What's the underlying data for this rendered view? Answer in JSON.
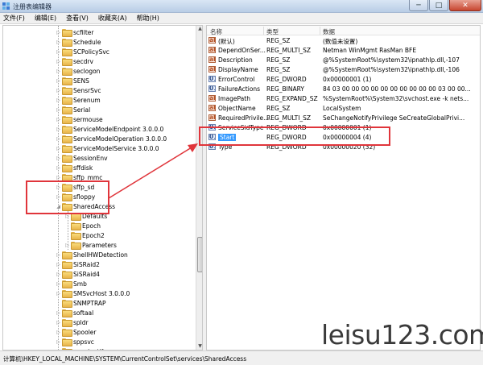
{
  "window": {
    "title": "注册表编辑器",
    "minimize_glyph": "─",
    "maximize_glyph": "□",
    "close_glyph": "✕"
  },
  "menu": [
    "文件(F)",
    "编辑(E)",
    "查看(V)",
    "收藏夹(A)",
    "帮助(H)"
  ],
  "tree": {
    "items": [
      {
        "label": "scfilter",
        "expander": "▷"
      },
      {
        "label": "Schedule",
        "expander": "▷"
      },
      {
        "label": "SCPolicySvc",
        "expander": "▷"
      },
      {
        "label": "secdrv",
        "expander": "▷"
      },
      {
        "label": "seclogon",
        "expander": "▷"
      },
      {
        "label": "SENS",
        "expander": "▷"
      },
      {
        "label": "SensrSvc",
        "expander": "▷"
      },
      {
        "label": "Serenum",
        "expander": "▷"
      },
      {
        "label": "Serial",
        "expander": "▷"
      },
      {
        "label": "sermouse",
        "expander": "▷"
      },
      {
        "label": "ServiceModelEndpoint 3.0.0.0",
        "expander": "▷"
      },
      {
        "label": "ServiceModelOperation 3.0.0.0",
        "expander": "▷"
      },
      {
        "label": "ServiceModelService 3.0.0.0",
        "expander": "▷"
      },
      {
        "label": "SessionEnv",
        "expander": "▷"
      },
      {
        "label": "sffdisk",
        "expander": "▷"
      },
      {
        "label": "sffp_mmc",
        "expander": "▷"
      },
      {
        "label": "sffp_sd",
        "expander": "▷"
      },
      {
        "label": "sfloppy",
        "expander": "▷"
      },
      {
        "label": "SharedAccess",
        "expander": "◢"
      },
      {
        "label": "Defaults",
        "expander": "▷"
      },
      {
        "label": "Epoch",
        "expander": ""
      },
      {
        "label": "Epoch2",
        "expander": ""
      },
      {
        "label": "Parameters",
        "expander": "▷"
      },
      {
        "label": "ShellHWDetection",
        "expander": "▷"
      },
      {
        "label": "SiSRaid2",
        "expander": "▷"
      },
      {
        "label": "SiSRaid4",
        "expander": "▷"
      },
      {
        "label": "Smb",
        "expander": "▷"
      },
      {
        "label": "SMSvcHost 3.0.0.0",
        "expander": "▷"
      },
      {
        "label": "SNMPTRAP",
        "expander": ""
      },
      {
        "label": "softaal",
        "expander": "▷"
      },
      {
        "label": "spldr",
        "expander": "▷"
      },
      {
        "label": "Spooler",
        "expander": "▷"
      },
      {
        "label": "sppsvc",
        "expander": "▷"
      },
      {
        "label": "sppuinotify",
        "expander": "▷"
      },
      {
        "label": "srv",
        "expander": "▷"
      }
    ],
    "scroll_up": "▲",
    "scroll_down": "▼"
  },
  "values": {
    "columns": [
      "名称",
      "类型",
      "数据"
    ],
    "rows": [
      {
        "icon": "ab",
        "name": "(默认)",
        "type": "REG_SZ",
        "data": "(数值未设置)"
      },
      {
        "icon": "ab",
        "name": "DependOnSer...",
        "type": "REG_MULTI_SZ",
        "data": "Netman WinMgmt RasMan BFE"
      },
      {
        "icon": "ab",
        "name": "Description",
        "type": "REG_SZ",
        "data": "@%SystemRoot%\\system32\\ipnathlp.dll,-107"
      },
      {
        "icon": "ab",
        "name": "DisplayName",
        "type": "REG_SZ",
        "data": "@%SystemRoot%\\system32\\ipnathlp.dll,-106"
      },
      {
        "icon": "011",
        "name": "ErrorControl",
        "type": "REG_DWORD",
        "data": "0x00000001 (1)"
      },
      {
        "icon": "011",
        "name": "FailureActions",
        "type": "REG_BINARY",
        "data": "84 03 00 00 00 00 00 00 00 00 00 00 03 00 00..."
      },
      {
        "icon": "ab",
        "name": "ImagePath",
        "type": "REG_EXPAND_SZ",
        "data": "%SystemRoot%\\System32\\svchost.exe -k nets..."
      },
      {
        "icon": "ab",
        "name": "ObjectName",
        "type": "REG_SZ",
        "data": "LocalSystem"
      },
      {
        "icon": "ab",
        "name": "RequiredPrivile...",
        "type": "REG_MULTI_SZ",
        "data": "SeChangeNotifyPrivilege SeCreateGlobalPrivi..."
      },
      {
        "icon": "011",
        "name": "ServiceSidType",
        "type": "REG_DWORD",
        "data": "0x00000001 (1)"
      },
      {
        "icon": "011",
        "name": "Start",
        "type": "REG_DWORD",
        "data": "0x00000004 (4)"
      },
      {
        "icon": "011",
        "name": "Type",
        "type": "REG_DWORD",
        "data": "0x00000020 (32)"
      }
    ]
  },
  "status": {
    "path": "计算机\\HKEY_LOCAL_MACHINE\\SYSTEM\\CurrentControlSet\\services\\SharedAccess"
  },
  "watermark": "leisu123.com",
  "colors": {
    "highlight_box": "#e0353b",
    "selection": "#3399ff"
  }
}
